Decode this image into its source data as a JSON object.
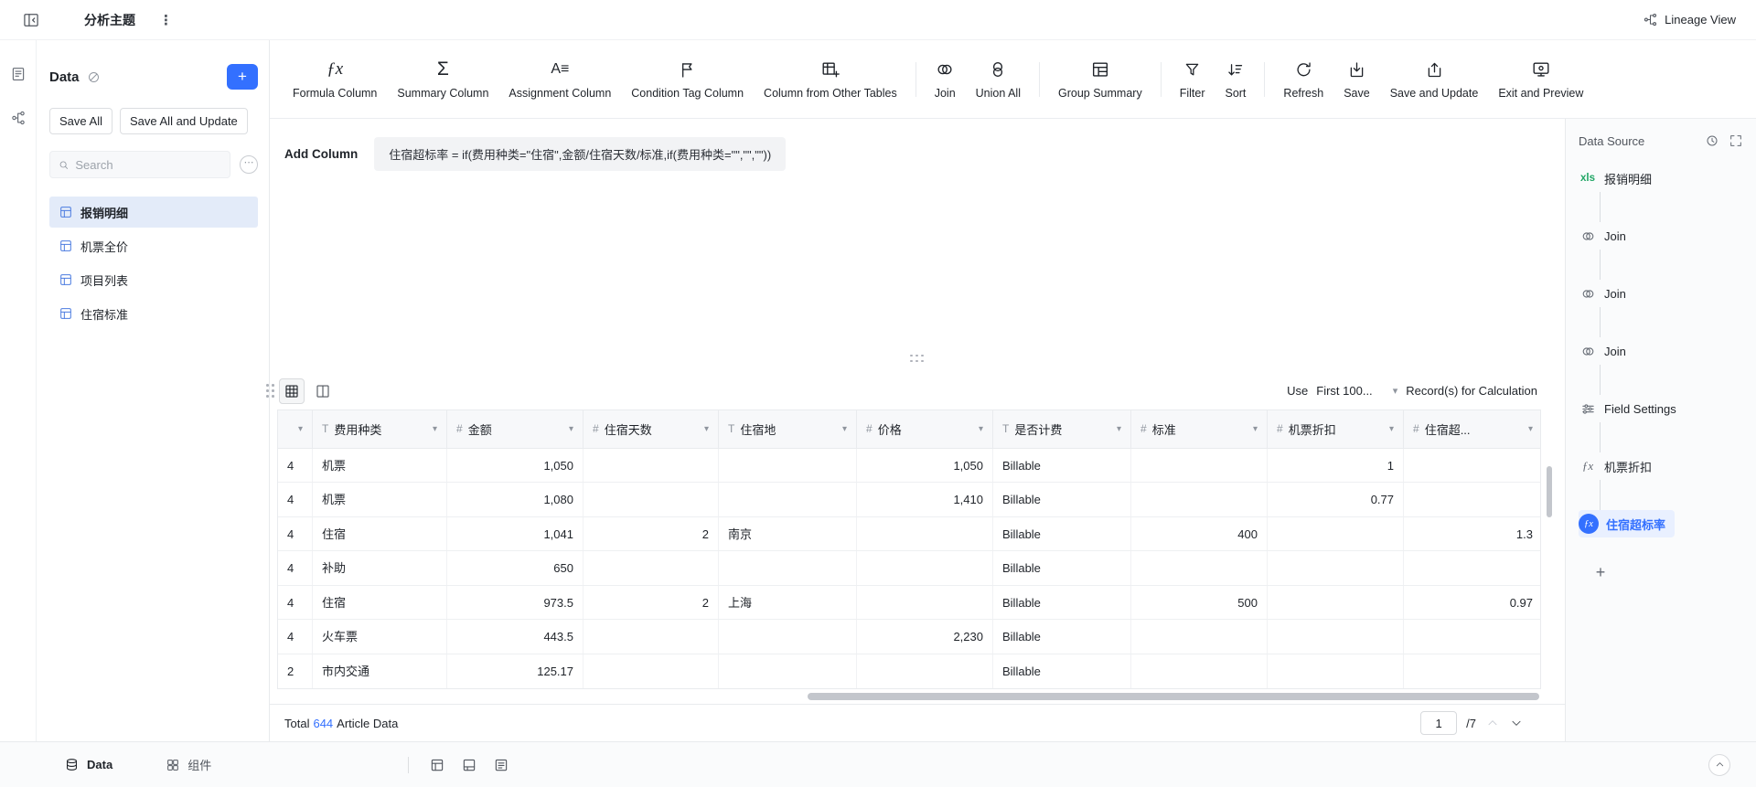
{
  "colors": {
    "accent": "#3370ff",
    "xls_green": "#21a665"
  },
  "icons": {
    "formula_column_glyph": "ƒx",
    "summary_column_glyph": "Σ",
    "assignment_glyph": "A≡",
    "fx_node_glyph": "ƒx",
    "kebab": "⋮",
    "ellipsis": "⋯",
    "caret_down": "▾",
    "plus": "+",
    "xls_badge": "xls"
  },
  "topbar": {
    "title": "分析主题",
    "lineage_view_label": "Lineage View"
  },
  "sidebar": {
    "title": "Data",
    "save_all_label": "Save All",
    "save_all_update_label": "Save All and Update",
    "search_placeholder": "Search",
    "items": [
      {
        "label": "报销明细",
        "selected": true
      },
      {
        "label": "机票全价",
        "selected": false
      },
      {
        "label": "项目列表",
        "selected": false
      },
      {
        "label": "住宿标准",
        "selected": false
      }
    ]
  },
  "toolbar": {
    "items": [
      {
        "label": "Formula Column"
      },
      {
        "label": "Summary Column"
      },
      {
        "label": "Assignment Column"
      },
      {
        "label": "Condition Tag Column"
      },
      {
        "label": "Column from Other Tables"
      },
      {
        "label": "Join"
      },
      {
        "label": "Union All"
      },
      {
        "label": "Group Summary"
      },
      {
        "label": "Filter"
      },
      {
        "label": "Sort"
      },
      {
        "label": "Refresh"
      },
      {
        "label": "Save"
      },
      {
        "label": "Save and Update"
      },
      {
        "label": "Exit and Preview"
      }
    ]
  },
  "formula_bar": {
    "label": "Add Column",
    "formula": "住宿超标率 = if(费用种类=\"住宿\",金额/住宿天数/标准,if(费用种类=\"\",\"\",\"\"))"
  },
  "table_toolbar": {
    "use_label": "Use",
    "records_dropdown_value": "First 100...",
    "records_suffix": "Record(s) for Calculation"
  },
  "table": {
    "columns": [
      {
        "type": "",
        "label": "",
        "align": "left"
      },
      {
        "type": "T",
        "label": "费用种类",
        "align": "left"
      },
      {
        "type": "#",
        "label": "金额",
        "align": "right"
      },
      {
        "type": "#",
        "label": "住宿天数",
        "align": "right"
      },
      {
        "type": "T",
        "label": "住宿地",
        "align": "left"
      },
      {
        "type": "#",
        "label": "价格",
        "align": "right"
      },
      {
        "type": "T",
        "label": "是否计费",
        "align": "left"
      },
      {
        "type": "#",
        "label": "标准",
        "align": "right"
      },
      {
        "type": "#",
        "label": "机票折扣",
        "align": "right"
      },
      {
        "type": "#",
        "label": "住宿超...",
        "align": "right"
      }
    ],
    "rows": [
      [
        "4",
        "机票",
        "1,050",
        "",
        "",
        "1,050",
        "Billable",
        "",
        "1",
        ""
      ],
      [
        "4",
        "机票",
        "1,080",
        "",
        "",
        "1,410",
        "Billable",
        "",
        "0.77",
        ""
      ],
      [
        "4",
        "住宿",
        "1,041",
        "2",
        "南京",
        "",
        "Billable",
        "400",
        "",
        "1.3"
      ],
      [
        "4",
        "补助",
        "650",
        "",
        "",
        "",
        "Billable",
        "",
        "",
        ""
      ],
      [
        "4",
        "住宿",
        "973.5",
        "2",
        "上海",
        "",
        "Billable",
        "500",
        "",
        "0.97"
      ],
      [
        "4",
        "火车票",
        "443.5",
        "",
        "",
        "2,230",
        "Billable",
        "",
        "",
        ""
      ],
      [
        "2",
        "市内交通",
        "125.17",
        "",
        "",
        "",
        "Billable",
        "",
        "",
        ""
      ]
    ]
  },
  "table_footer": {
    "total_label": "Total",
    "total_count": "644",
    "total_suffix": "Article Data",
    "page_value": "1",
    "page_total": "/7"
  },
  "data_source_panel": {
    "title": "Data Source",
    "nodes": [
      {
        "type": "xls",
        "label": "报销明细"
      },
      {
        "type": "join",
        "label": "Join"
      },
      {
        "type": "join",
        "label": "Join"
      },
      {
        "type": "join",
        "label": "Join"
      },
      {
        "type": "fields",
        "label": "Field Settings"
      },
      {
        "type": "formula",
        "label": "机票折扣"
      },
      {
        "type": "formula",
        "label": "住宿超标率",
        "selected": true
      }
    ]
  },
  "bottombar": {
    "tabs": [
      {
        "label": "Data",
        "active": true
      },
      {
        "label": "组件",
        "active": false
      }
    ]
  }
}
